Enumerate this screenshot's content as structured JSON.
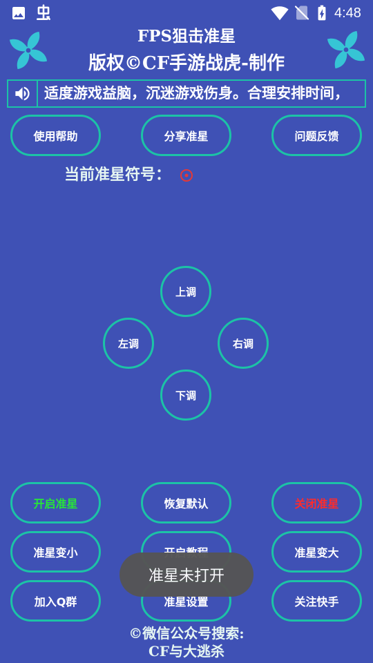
{
  "status_bar": {
    "time": "4:48",
    "left_icons": [
      "image-icon",
      "bug-icon"
    ],
    "right_icons": [
      "wifi-icon",
      "no-sim-icon",
      "battery-charging-icon"
    ]
  },
  "header": {
    "title": "FPS狙击准星",
    "subtitle": "版权©CF手游战虎-制作",
    "logo_icon": "pinwheel-icon"
  },
  "marquee": {
    "icon": "speaker-icon",
    "text": "适度游戏益脑，沉迷游戏伤身。合理安排时间，"
  },
  "top_buttons": [
    {
      "label": "使用帮助"
    },
    {
      "label": "分享准星"
    },
    {
      "label": "问题反馈"
    }
  ],
  "crosshair": {
    "label": "当前准星符号：",
    "symbol_icon": "circle-dot-crosshair-icon"
  },
  "dpad": {
    "up": "上调",
    "left": "左调",
    "right": "右调",
    "down": "下调"
  },
  "bottom_buttons": [
    [
      {
        "label": "开启准星"
      },
      {
        "label": "恢复默认"
      },
      {
        "label": "关闭准星"
      }
    ],
    [
      {
        "label": "准星变小"
      },
      {
        "label": "开启教程"
      },
      {
        "label": "准星变大"
      }
    ],
    [
      {
        "label": "加入Q群"
      },
      {
        "label": "准星设置"
      },
      {
        "label": "关注快手"
      }
    ]
  ],
  "toast": {
    "text": "准星未打开"
  },
  "footer": {
    "line1": "©微信公众号搜索:",
    "line2": "CF与大逃杀"
  },
  "colors": {
    "background": "#3F51B5",
    "accent": "#1CC3A6",
    "pinwheel": "#36C5D5",
    "text": "#FFFFFF",
    "label": "#E6F6F2",
    "on_button": "#27E637",
    "off_button": "#FF2B2B",
    "toast": "#555555",
    "crosshair_symbol": "#E53935"
  }
}
